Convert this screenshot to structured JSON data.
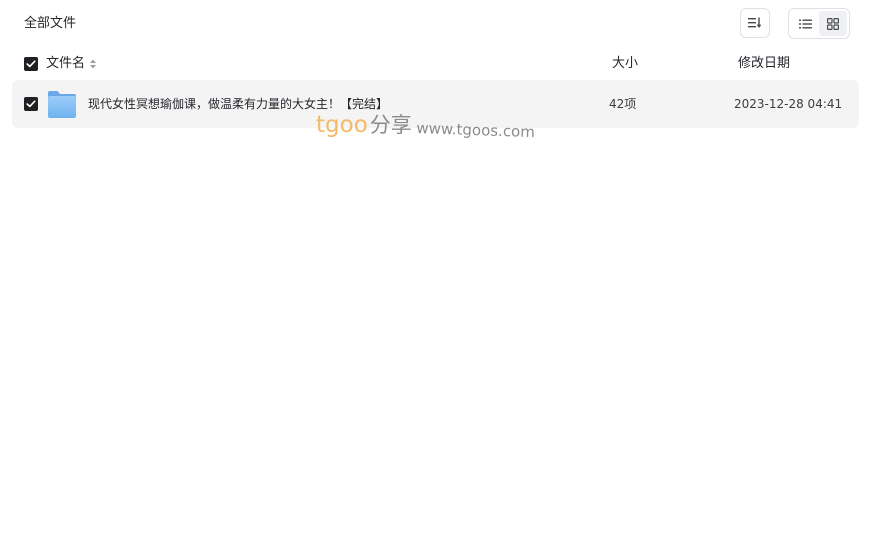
{
  "breadcrumb": {
    "label": "全部文件"
  },
  "toolbar": {
    "sort_icon": "sort-icon",
    "list_view_icon": "list-view-icon",
    "grid_view_icon": "grid-view-icon"
  },
  "table": {
    "columns": {
      "name": "文件名",
      "size": "大小",
      "modified": "修改日期"
    },
    "rows": [
      {
        "icon": "folder-icon",
        "name": "现代女性冥想瑜伽课，做温柔有力量的大女主！【完结】",
        "size": "42项",
        "modified": "2023-12-28 04:41",
        "checked": true
      }
    ]
  },
  "watermark": {
    "brand": "tgoo",
    "cn": "分享",
    "url": "www.tgoos.com"
  },
  "colors": {
    "checkbox": "#1f2024",
    "row_background": "#f4f4f5",
    "folder_blue": "#8ac3f5",
    "watermark_orange": "#f5b968"
  }
}
